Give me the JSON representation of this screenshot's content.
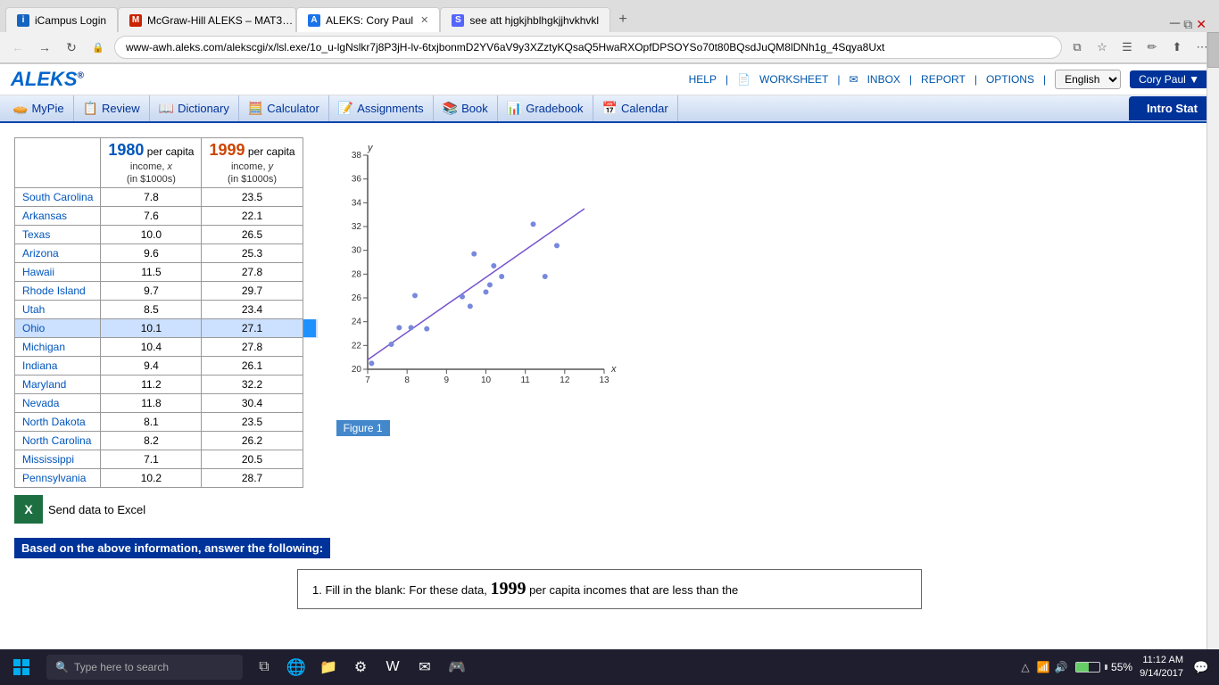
{
  "browser": {
    "tabs": [
      {
        "id": "tab1",
        "favicon_color": "#1565c0",
        "label": "iCampus Login",
        "active": false,
        "favicon_letter": "i"
      },
      {
        "id": "tab2",
        "favicon_color": "#cc2200",
        "label": "McGraw-Hill ALEKS – MAT3…",
        "active": false,
        "favicon_letter": "M"
      },
      {
        "id": "tab3",
        "favicon_color": "#1a73e8",
        "label": "ALEKS: Cory Paul",
        "active": true,
        "favicon_letter": "A"
      },
      {
        "id": "tab4",
        "favicon_color": "#5566ff",
        "label": "see att hjgkjhblhgkjjhvkhvkl",
        "active": false,
        "favicon_letter": "S"
      }
    ],
    "address": "www-awh.aleks.com/alekscgi/x/lsl.exe/1o_u-lgNslkr7j8P3jH-lv-6txjbonmD2YV6aV9y3XZztyKQsaQ5HwaRXOpfDPSOYSo70t80BQsdJuQM8lDNh1g_4Sqya8Uxt"
  },
  "aleks": {
    "logo": "ALEKS",
    "header_links": [
      "HELP",
      "WORKSHEET",
      "INBOX",
      "REPORT",
      "OPTIONS"
    ],
    "language": "English",
    "user": "Cory Paul",
    "nav": {
      "items": [
        {
          "label": "MyPie",
          "icon": "🥧"
        },
        {
          "label": "Review",
          "icon": "📋"
        },
        {
          "label": "Dictionary",
          "icon": "📖"
        },
        {
          "label": "Calculator",
          "icon": "🧮"
        },
        {
          "label": "Assignments",
          "icon": "📝"
        },
        {
          "label": "Book",
          "icon": "📚"
        },
        {
          "label": "Gradebook",
          "icon": "📊"
        },
        {
          "label": "Calendar",
          "icon": "📅"
        }
      ],
      "active_section": "Intro Stat"
    }
  },
  "table": {
    "col1_year": "1980",
    "col1_label": "per capita",
    "col1_sub": "income, x",
    "col1_unit": "(in $1000s)",
    "col2_year": "1999",
    "col2_label": "per capita",
    "col2_sub": "income, y",
    "col2_unit": "(in $1000s)",
    "rows": [
      {
        "state": "South Carolina",
        "x": "7.8",
        "y": "23.5",
        "selected": false
      },
      {
        "state": "Arkansas",
        "x": "7.6",
        "y": "22.1",
        "selected": false
      },
      {
        "state": "Texas",
        "x": "10.0",
        "y": "26.5",
        "selected": false
      },
      {
        "state": "Arizona",
        "x": "9.6",
        "y": "25.3",
        "selected": false
      },
      {
        "state": "Hawaii",
        "x": "11.5",
        "y": "27.8",
        "selected": false
      },
      {
        "state": "Rhode Island",
        "x": "9.7",
        "y": "29.7",
        "selected": false
      },
      {
        "state": "Utah",
        "x": "8.5",
        "y": "23.4",
        "selected": false
      },
      {
        "state": "Ohio",
        "x": "10.1",
        "y": "27.1",
        "selected": true
      },
      {
        "state": "Michigan",
        "x": "10.4",
        "y": "27.8",
        "selected": false
      },
      {
        "state": "Indiana",
        "x": "9.4",
        "y": "26.1",
        "selected": false
      },
      {
        "state": "Maryland",
        "x": "11.2",
        "y": "32.2",
        "selected": false
      },
      {
        "state": "Nevada",
        "x": "11.8",
        "y": "30.4",
        "selected": false
      },
      {
        "state": "North Dakota",
        "x": "8.1",
        "y": "23.5",
        "selected": false
      },
      {
        "state": "North Carolina",
        "x": "8.2",
        "y": "26.2",
        "selected": false
      },
      {
        "state": "Mississippi",
        "x": "7.1",
        "y": "20.5",
        "selected": false
      },
      {
        "state": "Pennsylvania",
        "x": "10.2",
        "y": "28.7",
        "selected": false
      }
    ],
    "excel_label": "Send data to Excel"
  },
  "chart": {
    "figure_label": "Figure 1",
    "x_axis_label": "x",
    "y_axis_label": "y",
    "x_ticks": [
      7,
      8,
      9,
      10,
      11,
      12,
      13
    ],
    "y_ticks": [
      20,
      22,
      24,
      26,
      28,
      30,
      32,
      34,
      36,
      38
    ],
    "points": [
      {
        "x": 7.8,
        "y": 23.5
      },
      {
        "x": 7.6,
        "y": 22.1
      },
      {
        "x": 10.0,
        "y": 26.5
      },
      {
        "x": 9.6,
        "y": 25.3
      },
      {
        "x": 11.5,
        "y": 27.8
      },
      {
        "x": 9.7,
        "y": 29.7
      },
      {
        "x": 8.5,
        "y": 23.4
      },
      {
        "x": 10.1,
        "y": 27.1
      },
      {
        "x": 10.4,
        "y": 27.8
      },
      {
        "x": 9.4,
        "y": 26.1
      },
      {
        "x": 11.2,
        "y": 32.2
      },
      {
        "x": 11.8,
        "y": 30.4
      },
      {
        "x": 8.1,
        "y": 23.5
      },
      {
        "x": 8.2,
        "y": 26.2
      },
      {
        "x": 7.1,
        "y": 20.5
      },
      {
        "x": 10.2,
        "y": 28.7
      }
    ],
    "regression_line": {
      "x1": 7,
      "y1": 20.8,
      "x2": 12.5,
      "y2": 33.5
    }
  },
  "bottom": {
    "instruction": "Based on the above information, answer the following:",
    "question_start": "1. Fill in the blank: For these data,",
    "year_big": "1999",
    "question_end": "per capita incomes that are less than the"
  },
  "taskbar": {
    "search_placeholder": "Type here to search",
    "time": "11:12 AM",
    "date": "9/14/2017",
    "battery_pct": "55%"
  }
}
